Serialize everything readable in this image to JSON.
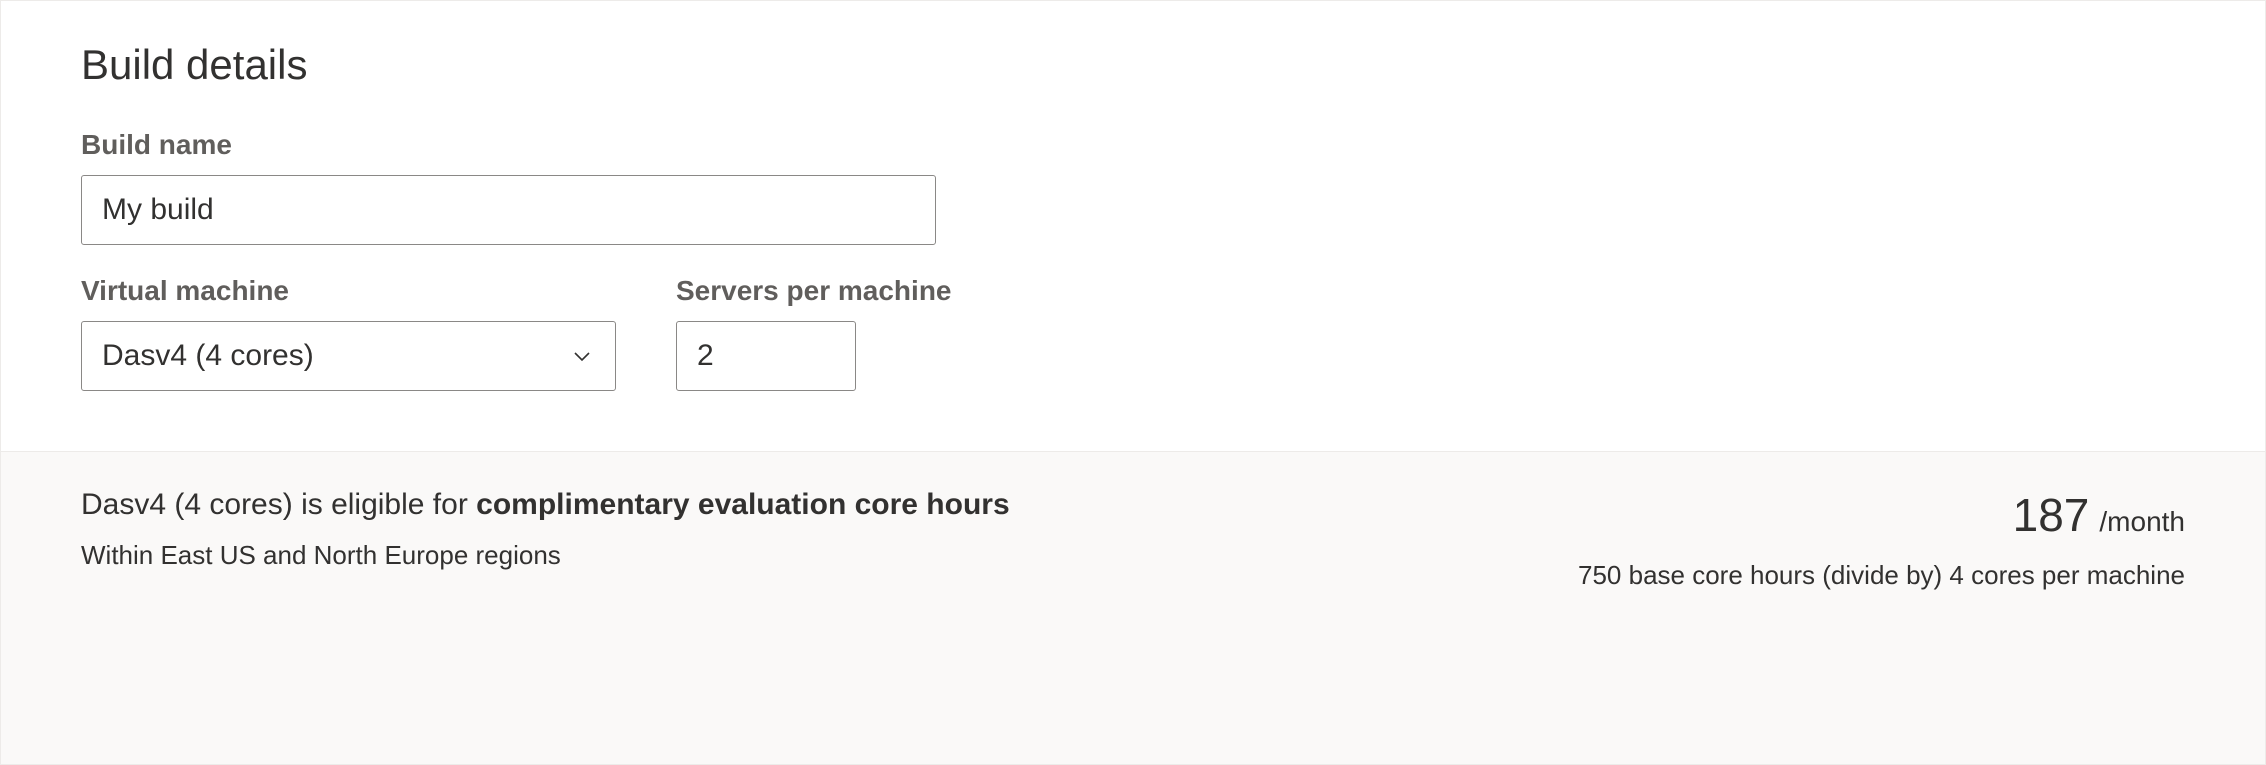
{
  "section": {
    "title": "Build details"
  },
  "fields": {
    "buildName": {
      "label": "Build name",
      "value": "My build"
    },
    "virtualMachine": {
      "label": "Virtual machine",
      "value": "Dasv4 (4 cores)"
    },
    "serversPerMachine": {
      "label": "Servers per machine",
      "value": "2"
    }
  },
  "summary": {
    "eligibilityPrefix": "Dasv4 (4 cores) is eligible for ",
    "eligibilityBold": "complimentary evaluation core hours",
    "regionNote": "Within East US and North Europe regions",
    "hoursNumber": "187",
    "hoursUnit": "/month",
    "calculation": "750 base core hours (divide by) 4 cores per machine"
  }
}
